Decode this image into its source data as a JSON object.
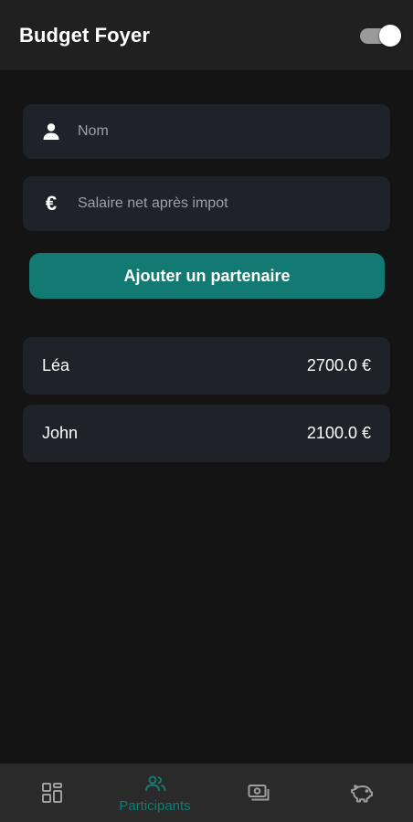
{
  "header": {
    "title": "Budget Foyer",
    "theme_toggle_on": true
  },
  "form": {
    "name_placeholder": "Nom",
    "salary_placeholder": "Salaire net après impot",
    "name_icon": "person-icon",
    "salary_icon": "euro-icon",
    "salary_icon_glyph": "€",
    "add_button_label": "Ajouter un partenaire"
  },
  "partners": [
    {
      "name": "Léa",
      "salary": "2700.0 €"
    },
    {
      "name": "John",
      "salary": "2100.0 €"
    }
  ],
  "nav": {
    "items": [
      {
        "icon": "dashboard-icon",
        "label": "",
        "active": false
      },
      {
        "icon": "participants-icon",
        "label": "Participants",
        "active": true
      },
      {
        "icon": "money-icon",
        "label": "",
        "active": false
      },
      {
        "icon": "piggy-bank-icon",
        "label": "",
        "active": false
      }
    ]
  },
  "colors": {
    "background": "#141414",
    "header": "#202020",
    "card": "#1f2329",
    "accent": "#137a73",
    "nav_background": "#2a2a2a",
    "inactive_icon": "#9e9e9e"
  }
}
